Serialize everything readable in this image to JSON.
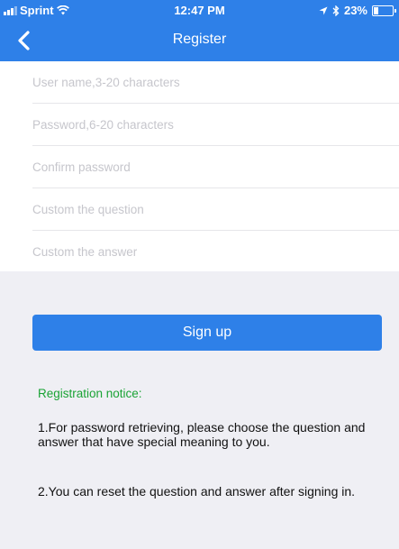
{
  "status_bar": {
    "carrier": "Sprint",
    "time": "12:47 PM",
    "battery": "23%"
  },
  "nav": {
    "title": "Register"
  },
  "form": {
    "fields": [
      {
        "placeholder": "User name,3-20 characters"
      },
      {
        "placeholder": "Password,6-20 characters"
      },
      {
        "placeholder": "Confirm password"
      },
      {
        "placeholder": "Custom the question"
      },
      {
        "placeholder": "Custom the answer"
      }
    ]
  },
  "signup_label": "Sign up",
  "notice": {
    "title": "Registration notice:",
    "item1": "1.For password retrieving, please choose the question and answer that have special meaning to you.",
    "item2": "2.You can reset the question and answer after signing in."
  },
  "colors": {
    "primary": "#2e80e8",
    "notice_title": "#1aa335",
    "background": "#efeff4"
  }
}
